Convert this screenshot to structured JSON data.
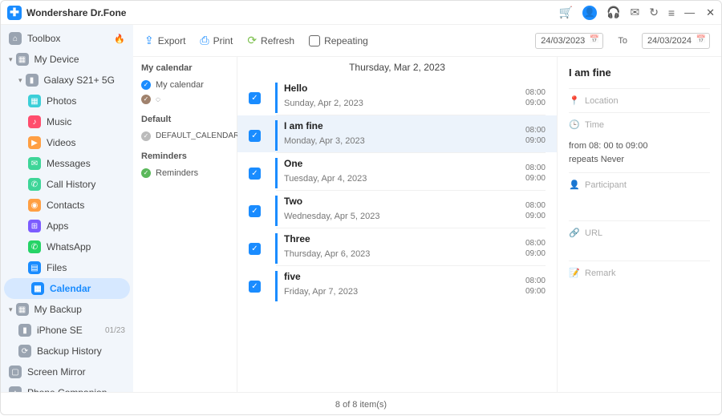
{
  "app": {
    "title": "Wondershare Dr.Fone"
  },
  "sidebar": {
    "toolbox": "Toolbox",
    "my_device": "My Device",
    "device": "Galaxy S21+ 5G",
    "items": [
      {
        "label": "Photos"
      },
      {
        "label": "Music"
      },
      {
        "label": "Videos"
      },
      {
        "label": "Messages"
      },
      {
        "label": "Call History"
      },
      {
        "label": "Contacts"
      },
      {
        "label": "Apps"
      },
      {
        "label": "WhatsApp"
      },
      {
        "label": "Files"
      },
      {
        "label": "Calendar"
      }
    ],
    "my_backup": "My Backup",
    "iphone": "iPhone SE",
    "iphone_badge": "01/23",
    "backup_history": "Backup History",
    "screen_mirror": "Screen Mirror",
    "phone_companion": "Phone Companion"
  },
  "toolbar": {
    "export": "Export",
    "print": "Print",
    "refresh": "Refresh",
    "repeating": "Repeating",
    "date_from": "24/03/2023",
    "to": "To",
    "date_to": "24/03/2024"
  },
  "calendars": {
    "sec1_h": "My calendar",
    "sec1_items": [
      {
        "label": "My calendar"
      },
      {
        "label": ""
      }
    ],
    "sec2_h": "Default",
    "sec2_items": [
      {
        "label": "DEFAULT_CALENDAR_NAME"
      }
    ],
    "sec3_h": "Reminders",
    "sec3_items": [
      {
        "label": "Reminders"
      }
    ]
  },
  "events_header": "Thursday, Mar 2, 2023",
  "events": [
    {
      "title": "Hello",
      "date": "Sunday, Apr 2, 2023",
      "t1": "08:00",
      "t2": "09:00"
    },
    {
      "title": "I am fine",
      "date": "Monday, Apr 3, 2023",
      "t1": "08:00",
      "t2": "09:00"
    },
    {
      "title": "One",
      "date": "Tuesday, Apr 4, 2023",
      "t1": "08:00",
      "t2": "09:00"
    },
    {
      "title": "Two",
      "date": "Wednesday, Apr 5, 2023",
      "t1": "08:00",
      "t2": "09:00"
    },
    {
      "title": "Three",
      "date": "Thursday, Apr 6, 2023",
      "t1": "08:00",
      "t2": "09:00"
    },
    {
      "title": "five",
      "date": "Friday, Apr 7, 2023",
      "t1": "08:00",
      "t2": "09:00"
    }
  ],
  "detail": {
    "title": "I am fine",
    "location": "Location",
    "time": "Time",
    "time_detail1": "from 08: 00 to 09:00",
    "time_detail2": "repeats Never",
    "participant": "Participant",
    "url": "URL",
    "remark": "Remark"
  },
  "footer": "8  of  8 item(s)"
}
